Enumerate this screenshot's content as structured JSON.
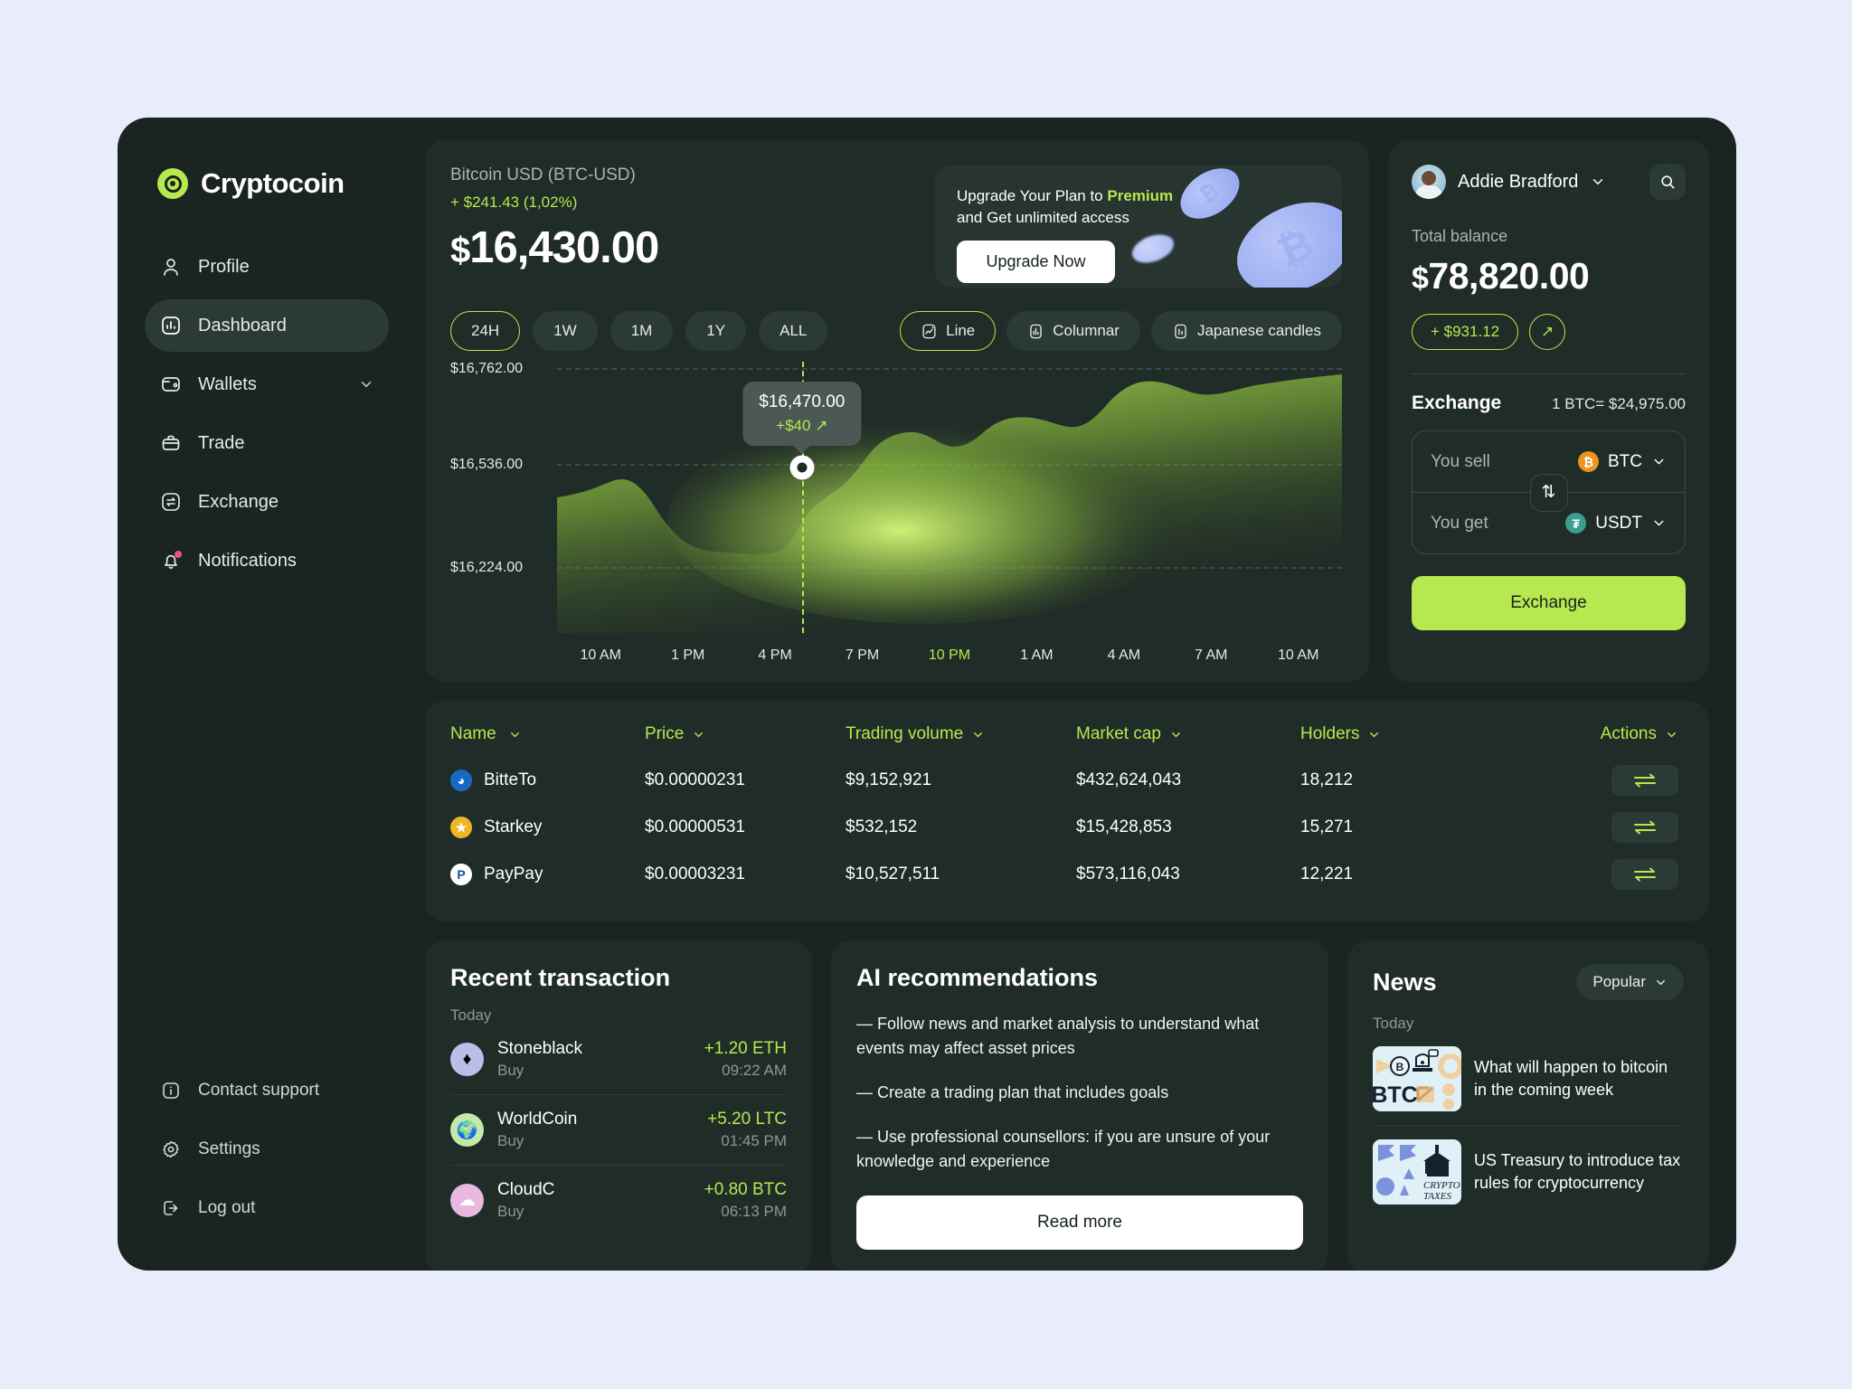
{
  "brand": {
    "name": "Cryptocoin"
  },
  "sidebar": {
    "items": [
      {
        "label": "Profile",
        "icon": "user-icon"
      },
      {
        "label": "Dashboard",
        "icon": "chart-bars-icon"
      },
      {
        "label": "Wallets",
        "icon": "wallet-icon"
      },
      {
        "label": "Trade",
        "icon": "briefcase-icon"
      },
      {
        "label": "Exchange",
        "icon": "exchange-arrows-icon"
      },
      {
        "label": "Notifications",
        "icon": "bell-icon"
      }
    ],
    "bottom": [
      {
        "label": "Contact support",
        "icon": "info-icon"
      },
      {
        "label": "Settings",
        "icon": "gear-icon"
      },
      {
        "label": "Log out",
        "icon": "logout-icon"
      }
    ]
  },
  "chart_panel": {
    "pair": "Bitcoin USD (BTC-USD)",
    "change": "+ $241.43 (1,02%)",
    "currency_symbol": "$",
    "price": "16,430.00",
    "ranges": [
      "24H",
      "1W",
      "1M",
      "1Y",
      "ALL"
    ],
    "active_range": "24H",
    "types": [
      "Line",
      "Columnar",
      "Japanese candles"
    ],
    "active_type": "Line"
  },
  "promo": {
    "line1_pre": "Upgrade Your Plan to ",
    "line1_accent": "Premium",
    "line2": "and Get unlimited access",
    "button": "Upgrade Now"
  },
  "chart_data": {
    "type": "area",
    "title": "Bitcoin USD (BTC-USD)",
    "xlabel": "",
    "ylabel": "",
    "grid": true,
    "ylim": [
      16224,
      16762
    ],
    "ytick_labels": [
      "$16,762.00",
      "$16,536.00",
      "$16,224.00"
    ],
    "ytick_values": [
      16762,
      16536,
      16224
    ],
    "xtick_labels": [
      "10 AM",
      "1 PM",
      "4 PM",
      "7 PM",
      "10 PM",
      "1 AM",
      "4 AM",
      "7 AM",
      "10 AM"
    ],
    "active_xtick": "10 PM",
    "series": [
      {
        "name": "BTC-USD",
        "color": "#b6e84f",
        "x": [
          "10 AM",
          "11 AM",
          "12 PM",
          "1 PM",
          "2 PM",
          "3 PM",
          "4 PM",
          "5 PM",
          "6 PM",
          "7 PM",
          "8 PM",
          "9 PM",
          "10 PM",
          "11 PM",
          "12 AM",
          "1 AM",
          "2 AM",
          "3 AM",
          "4 AM",
          "5 AM",
          "6 AM",
          "7 AM",
          "8 AM",
          "9 AM",
          "10 AM"
        ],
        "values": [
          16390,
          16430,
          16408,
          16362,
          16336,
          16330,
          16332,
          16334,
          16330,
          16336,
          16352,
          16420,
          16470,
          16516,
          16530,
          16522,
          16542,
          16578,
          16588,
          16600,
          16640,
          16686,
          16700,
          16712,
          16718
        ]
      }
    ],
    "tooltip": {
      "value": "$16,470.00",
      "delta": "+$40",
      "at": "10 PM"
    }
  },
  "account": {
    "user_name": "Addie Bradford",
    "balance_label": "Total balance",
    "currency_symbol": "$",
    "balance": "78,820.00",
    "change_badge": "+ $931.12"
  },
  "exchange": {
    "title": "Exchange",
    "rate": "1 BTC= $24,975.00",
    "sell_label": "You sell",
    "sell_token": "BTC",
    "sell_token_symbol": "₿",
    "sell_token_color": "#e8941f",
    "get_label": "You get",
    "get_token": "USDT",
    "get_token_symbol": "₮",
    "get_token_color": "#3d9e8f",
    "button": "Exchange"
  },
  "market_table": {
    "columns": [
      "Name",
      "Price",
      "Trading volume",
      "Market cap",
      "Holders",
      "Actions"
    ],
    "rows": [
      {
        "name": "BitteTo",
        "icon_color": "#1769c4",
        "icon_glyph": "◕",
        "price": "$0.00000231",
        "volume": "$9,152,921",
        "market_cap": "$432,624,043",
        "holders": "18,212"
      },
      {
        "name": "Starkey",
        "icon_color": "#f0b429",
        "icon_glyph": "★",
        "price": "$0.00000531",
        "volume": "$532,152",
        "market_cap": "$15,428,853",
        "holders": "15,271"
      },
      {
        "name": "PayPay",
        "icon_color": "#ffffff",
        "icon_glyph": "P",
        "price": "$0.00003231",
        "volume": "$10,527,511",
        "market_cap": "$573,116,043",
        "holders": "12,221"
      }
    ]
  },
  "recent_transaction": {
    "title": "Recent transaction",
    "subtitle": "Today",
    "items": [
      {
        "name": "Stoneblack",
        "type": "Buy",
        "amount": "+1.20 ETH",
        "time": "09:22 AM",
        "icon_color": "#b9bfe8",
        "icon_glyph": "♦"
      },
      {
        "name": "WorldCoin",
        "type": "Buy",
        "amount": "+5.20 LTC",
        "time": "01:45 PM",
        "icon_color": "#c4e8a8",
        "icon_glyph": "🌍"
      },
      {
        "name": "CloudC",
        "type": "Buy",
        "amount": "+0.80 BTC",
        "time": "06:13 PM",
        "icon_color": "#e8b9e0",
        "icon_glyph": "☁"
      }
    ]
  },
  "ai_recommendations": {
    "title": "AI recommendations",
    "items": [
      "— Follow news and market analysis to understand what events may affect asset prices",
      "— Create a trading plan that includes goals",
      "— Use professional counsellors: if you are unsure of your knowledge and experience"
    ],
    "button": "Read more"
  },
  "news": {
    "title": "News",
    "filter": "Popular",
    "subtitle": "Today",
    "items": [
      {
        "headline": "What will happen to bitcoin in the coming week",
        "thumb_label": "BTC",
        "thumb_theme": "btc"
      },
      {
        "headline": "US Treasury to introduce tax rules for cryptocurrency",
        "thumb_label": "CRYPTO TAXES",
        "thumb_theme": "taxes"
      }
    ]
  },
  "colors": {
    "accent_green": "#b6e84f",
    "app_bg": "#1a2420",
    "card_bg": "#202c27",
    "page_bg": "#e8ecfb"
  }
}
